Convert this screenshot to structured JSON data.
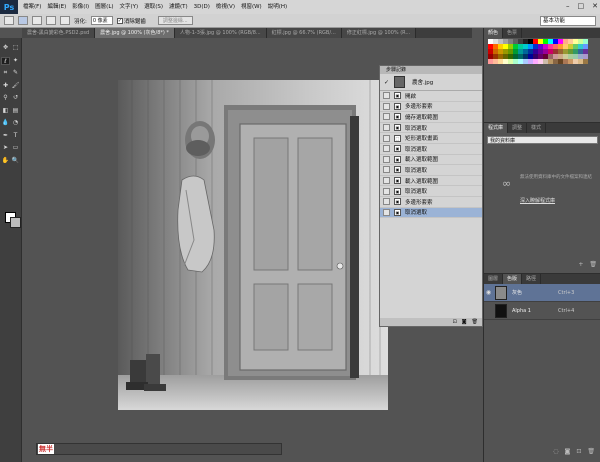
{
  "app": {
    "logo": "Ps"
  },
  "menu": [
    "檔案(F)",
    "編輯(E)",
    "影像(I)",
    "圖層(L)",
    "文字(Y)",
    "選取(S)",
    "濾鏡(T)",
    "3D(D)",
    "檢視(V)",
    "視窗(W)",
    "說明(H)"
  ],
  "window_controls": [
    "–",
    "□",
    "✕"
  ],
  "options": {
    "feather_label": "羽化:",
    "feather_value": "0 像素",
    "antialias_label": "消除鋸齒",
    "antialias_check": "✓",
    "refine_label": "調整邊緣...",
    "workspace": "基本功能"
  },
  "tabs": [
    {
      "label": "農舍-黑白變彩色.PSD2.psd",
      "active": false
    },
    {
      "label": "農舍.jpg @ 100% (灰色/8*) *",
      "active": true
    },
    {
      "label": "人物-1-3張.jpg @ 100% (RGB/8...",
      "active": false
    },
    {
      "label": "紅標.jpg @ 66.7% (RGB/...",
      "active": false
    },
    {
      "label": "修正紅標.jpg @ 100% (R...",
      "active": false
    }
  ],
  "tools": [
    {
      "name": "move-tool",
      "glyph": "✥"
    },
    {
      "name": "marquee-tool",
      "glyph": "⬚"
    },
    {
      "name": "lasso-tool",
      "glyph": "ℓ",
      "active": true
    },
    {
      "name": "magic-wand-tool",
      "glyph": "✦"
    },
    {
      "name": "crop-tool",
      "glyph": "⌗"
    },
    {
      "name": "eyedropper-tool",
      "glyph": "✎"
    },
    {
      "name": "healing-tool",
      "glyph": "✚"
    },
    {
      "name": "brush-tool",
      "glyph": "🖌"
    },
    {
      "name": "clone-stamp-tool",
      "glyph": "⚲"
    },
    {
      "name": "history-brush-tool",
      "glyph": "↺"
    },
    {
      "name": "eraser-tool",
      "glyph": "◧"
    },
    {
      "name": "gradient-tool",
      "glyph": "▤"
    },
    {
      "name": "blur-tool",
      "glyph": "💧"
    },
    {
      "name": "dodge-tool",
      "glyph": "◔"
    },
    {
      "name": "pen-tool",
      "glyph": "✒"
    },
    {
      "name": "type-tool",
      "glyph": "T"
    },
    {
      "name": "path-select-tool",
      "glyph": "➤"
    },
    {
      "name": "shape-tool",
      "glyph": "▭"
    },
    {
      "name": "hand-tool",
      "glyph": "✋"
    },
    {
      "name": "zoom-tool",
      "glyph": "🔍"
    }
  ],
  "status": {
    "zoom": "無半"
  },
  "history": {
    "title": "步驟記錄",
    "snapshot": "農舍.jpg",
    "items": [
      {
        "label": "開啟",
        "icon": "▣"
      },
      {
        "label": "多邊形套索",
        "icon": "▣"
      },
      {
        "label": "儲存選取範圍",
        "icon": "▣"
      },
      {
        "label": "取消選取",
        "icon": "▣"
      },
      {
        "label": "矩形選取畫面",
        "icon": "⬚"
      },
      {
        "label": "取消選取",
        "icon": "▣"
      },
      {
        "label": "載入選取範圍",
        "icon": "▣"
      },
      {
        "label": "取消選取",
        "icon": "▣"
      },
      {
        "label": "載入選取範圍",
        "icon": "▣"
      },
      {
        "label": "取消選取",
        "icon": "▣"
      },
      {
        "label": "多邊形套索",
        "icon": "▣"
      },
      {
        "label": "取消選取",
        "icon": "▣",
        "selected": true
      }
    ],
    "footer": [
      "⊡",
      "◙",
      "🗑"
    ]
  },
  "right_panels": {
    "top_tabs": [
      "顏色",
      "色票"
    ],
    "mid_tabs": [
      "程式庫",
      "調整",
      "樣式"
    ],
    "library_select": "我的資料庫",
    "library_msg": "無法使用資料庫中的文件檔案和連結",
    "library_link": "深入瞭解程式庫",
    "library_footer": [
      "+",
      "🗑"
    ],
    "bottom_tabs": [
      "圖層",
      "色版",
      "路徑"
    ],
    "channels": [
      {
        "name": "灰色",
        "shortcut": "Ctrl+3",
        "selected": true,
        "thumb": "#8a8a8a"
      },
      {
        "name": "Alpha 1",
        "shortcut": "Ctrl+4",
        "selected": false,
        "thumb": "#111"
      }
    ],
    "channel_footer": [
      "◌",
      "◙",
      "⊡",
      "🗑"
    ]
  },
  "swatch_colors": [
    "#ffffff",
    "#e0e0e0",
    "#c0c0c0",
    "#a0a0a0",
    "#808080",
    "#606060",
    "#404040",
    "#202020",
    "#000000",
    "#ff0000",
    "#ffff00",
    "#00ff00",
    "#00ffff",
    "#0000ff",
    "#ff00ff",
    "#ffaa88",
    "#ffcc99",
    "#ffff99",
    "#ccff99",
    "#99ffcc",
    "#ff0000",
    "#ff6600",
    "#ffcc00",
    "#ffff00",
    "#99cc00",
    "#00cc33",
    "#00cc99",
    "#00cccc",
    "#0099ff",
    "#0033cc",
    "#6600cc",
    "#cc00cc",
    "#ff3399",
    "#ff6666",
    "#ff9933",
    "#ffcc66",
    "#cccc33",
    "#66cc66",
    "#33cccc",
    "#6699ff",
    "#cc0000",
    "#cc6600",
    "#cc9900",
    "#999900",
    "#669900",
    "#009933",
    "#009999",
    "#006699",
    "#003399",
    "#330099",
    "#660099",
    "#990099",
    "#cc0066",
    "#993333",
    "#996633",
    "#999933",
    "#669933",
    "#339966",
    "#336699",
    "#663399",
    "#990000",
    "#993300",
    "#996600",
    "#666600",
    "#336600",
    "#006633",
    "#006666",
    "#003366",
    "#000099",
    "#330066",
    "#660066",
    "#660033",
    "#996666",
    "#cc9999",
    "#ccaa88",
    "#cccc99",
    "#aacc99",
    "#99ccaa",
    "#99aacc",
    "#aa99cc",
    "#ff9999",
    "#ffbb99",
    "#ffdd99",
    "#ffffcc",
    "#ddffaa",
    "#aaffcc",
    "#aaffff",
    "#aaccff",
    "#ccaaff",
    "#ffaaff",
    "#ffccee",
    "#ccbbaa",
    "#bb9966",
    "#886644",
    "#664422",
    "#aa7755",
    "#cc9966",
    "#eeccaa",
    "#ddbb88",
    "#997744"
  ]
}
